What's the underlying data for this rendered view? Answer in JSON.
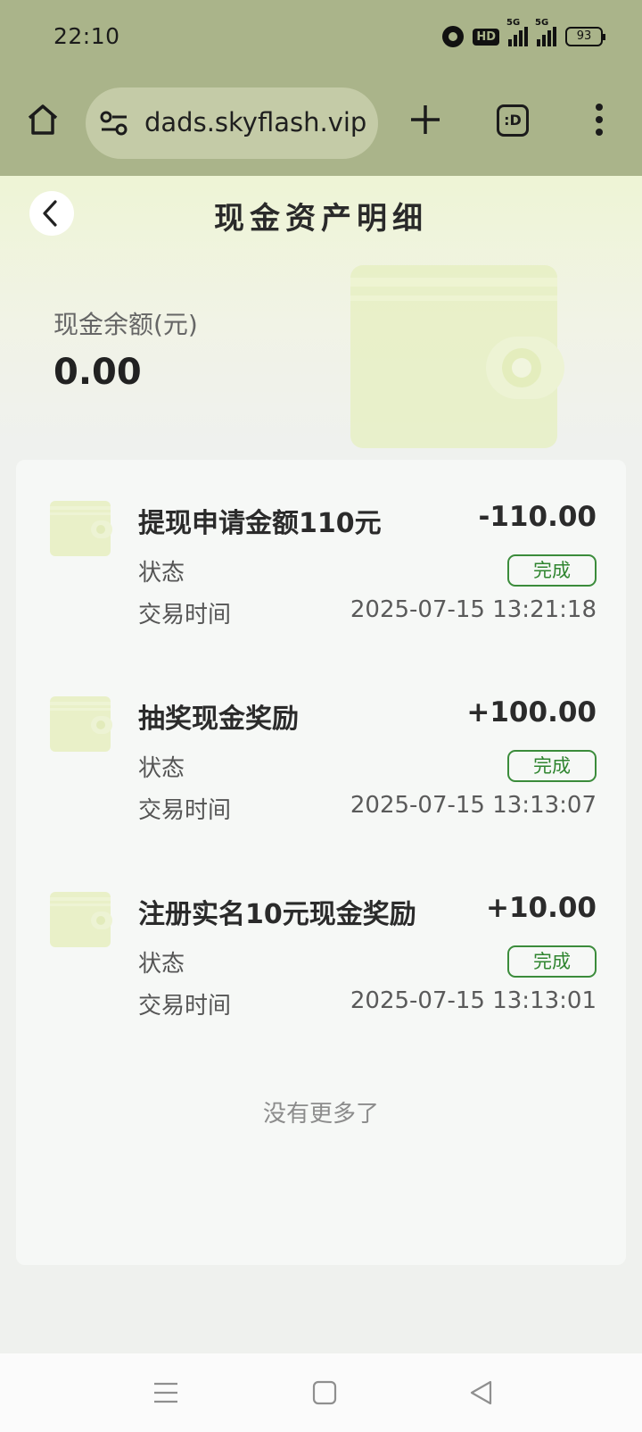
{
  "status_bar": {
    "time": "22:10",
    "hd_label": "HD",
    "signal1_label": "5G",
    "signal2_label": "5G",
    "battery": "93"
  },
  "browser": {
    "url": "dads.skyflash.vip",
    "tabs_label": ":D"
  },
  "page": {
    "title": "现金资产明细",
    "balance_label": "现金余额(元)",
    "balance_value": "0.00"
  },
  "transactions": [
    {
      "title": "提现申请金额110元",
      "amount": "-110.00",
      "status_label": "状态",
      "status": "完成",
      "time_label": "交易时间",
      "time": "2025-07-15 13:21:18"
    },
    {
      "title": "抽奖现金奖励",
      "amount": "+100.00",
      "status_label": "状态",
      "status": "完成",
      "time_label": "交易时间",
      "time": "2025-07-15 13:13:07"
    },
    {
      "title": "注册实名10元现金奖励",
      "amount": "+10.00",
      "status_label": "状态",
      "status": "完成",
      "time_label": "交易时间",
      "time": "2025-07-15 13:13:01"
    }
  ],
  "footer_text": "没有更多了",
  "colors": {
    "chrome": "#aab48a",
    "url_pill": "#c4cba7",
    "status_green": "#2f852f",
    "wallet_tint": "#e6efbf"
  },
  "icons": {
    "home": "home-icon",
    "site_settings": "tune-icon",
    "new_tab": "plus-icon",
    "tabs": "tabs-icon",
    "menu": "more-vert-icon",
    "back": "chevron-left-icon",
    "wallet": "wallet-icon",
    "nav_menu": "menu-lines-icon",
    "nav_home": "square-icon",
    "nav_back": "triangle-back-icon"
  }
}
